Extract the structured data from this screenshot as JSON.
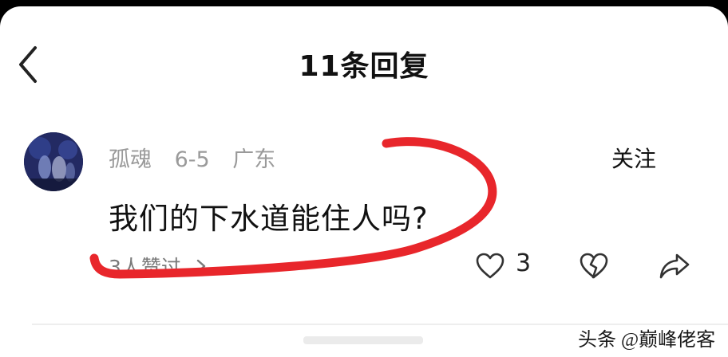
{
  "header": {
    "title": "11条回复"
  },
  "comment": {
    "username": "孤魂",
    "date": "6-5",
    "location": "广东",
    "follow_label": "关注",
    "text": "我们的下水道能住人吗?",
    "likes_label": "3人赞过",
    "like_count": "3"
  },
  "icons": {
    "back": "chevron-left-icon",
    "likes_more": "chevron-right-icon",
    "like": "heart-outline-icon",
    "dislike": "broken-heart-icon",
    "share": "share-arrow-icon"
  },
  "watermark": {
    "text": "头条 @巅峰佬客"
  },
  "colors": {
    "annotation_stroke": "#e8262b",
    "meta_gray": "#9a9a9a",
    "text_dark": "#111111"
  }
}
